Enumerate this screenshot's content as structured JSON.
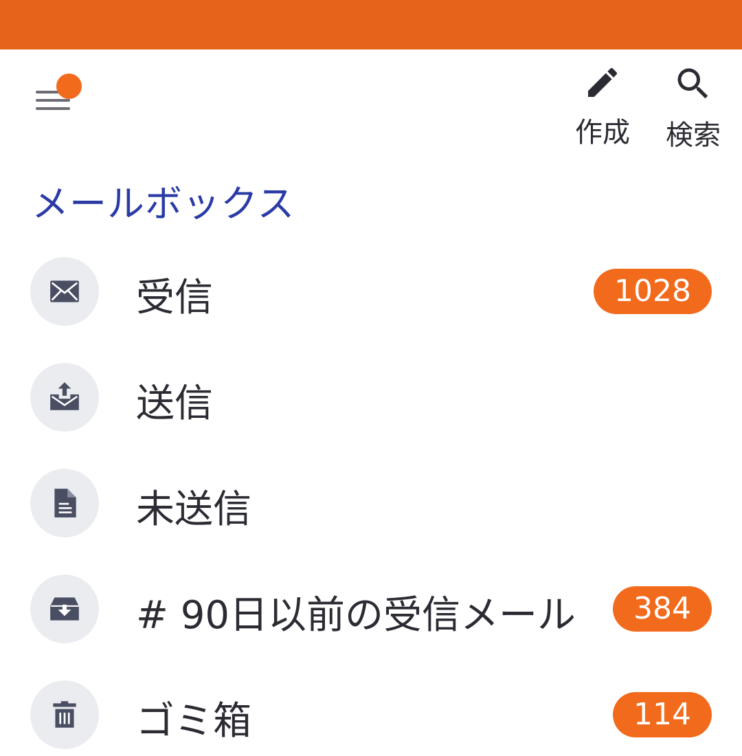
{
  "toolbar": {
    "compose_label": "作成",
    "search_label": "検索"
  },
  "section_title": "メールボックス",
  "mailboxes": [
    {
      "label": "受信",
      "icon": "inbox-envelope-icon",
      "badge": "1028"
    },
    {
      "label": "送信",
      "icon": "sent-envelope-icon",
      "badge": ""
    },
    {
      "label": "未送信",
      "icon": "draft-document-icon",
      "badge": ""
    },
    {
      "label": "# 90日以前の受信メール",
      "icon": "archive-tray-icon",
      "badge": "384"
    },
    {
      "label": "ゴミ箱",
      "icon": "trash-icon",
      "badge": "114"
    }
  ],
  "colors": {
    "status_bar": "#e5631a",
    "accent": "#f26a1c",
    "section_title": "#2a3ba6",
    "icon_circle": "#ebecf0",
    "icon": "#4a4e63"
  }
}
